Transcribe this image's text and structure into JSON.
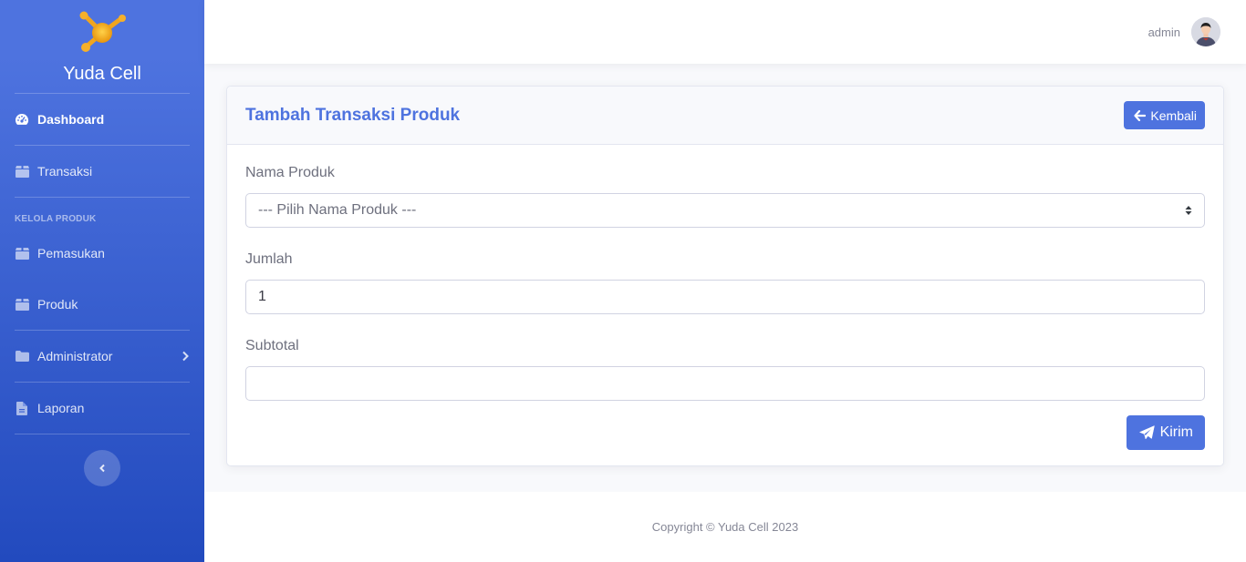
{
  "brand": {
    "name": "Yuda Cell",
    "logo_icon": "molecule-logo"
  },
  "sidebar": {
    "items": [
      {
        "label": "Dashboard",
        "icon": "tachometer-icon",
        "active": true
      },
      {
        "label": "Transaksi",
        "icon": "box-icon"
      }
    ],
    "heading": "KELOLA PRODUK",
    "items2": [
      {
        "label": "Pemasukan",
        "icon": "box-icon"
      },
      {
        "label": "Produk",
        "icon": "box-icon"
      },
      {
        "label": "Administrator",
        "icon": "folder-icon",
        "has_chevron": true
      },
      {
        "label": "Laporan",
        "icon": "file-icon"
      }
    ]
  },
  "topbar": {
    "user_name": "admin"
  },
  "card": {
    "title": "Tambah Transaksi Produk",
    "back_label": "Kembali",
    "fields": {
      "produk_label": "Nama Produk",
      "produk_value": "--- Pilih Nama Produk ---",
      "jumlah_label": "Jumlah",
      "jumlah_value": "1",
      "subtotal_label": "Subtotal",
      "subtotal_value": ""
    },
    "submit_label": "Kirim"
  },
  "footer": {
    "text": "Copyright © Yuda Cell 2023"
  },
  "colors": {
    "primary": "#4e73df",
    "sidebar_gradient_end": "#224abe"
  }
}
